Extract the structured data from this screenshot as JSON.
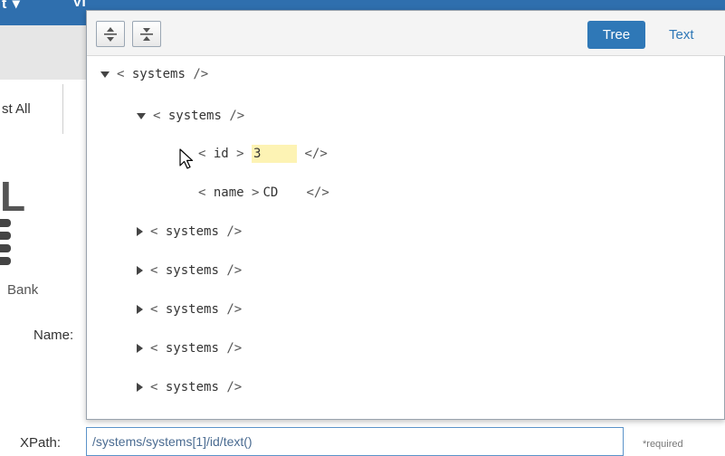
{
  "background": {
    "list_all_label": "st All",
    "bank_label": "Bank",
    "name_label": "Name:",
    "xpath_label": "XPath:",
    "xpath_value": "/systems/systems[1]/id/text()",
    "required_label": "*required",
    "logo_letter": "L"
  },
  "popup": {
    "toolbar": {
      "expand_icon": "expand-all-icon",
      "collapse_icon": "collapse-all-icon",
      "tree_label": "Tree",
      "text_label": "Text"
    },
    "tree": {
      "root_tag": "systems",
      "child_tag": "systems",
      "id_tag": "id",
      "id_value": "3",
      "name_tag": "name",
      "name_value": "CD",
      "collapsed_tag": "systems"
    }
  },
  "colors": {
    "accent": "#2f78b7",
    "highlight": "#fdf3b4"
  }
}
